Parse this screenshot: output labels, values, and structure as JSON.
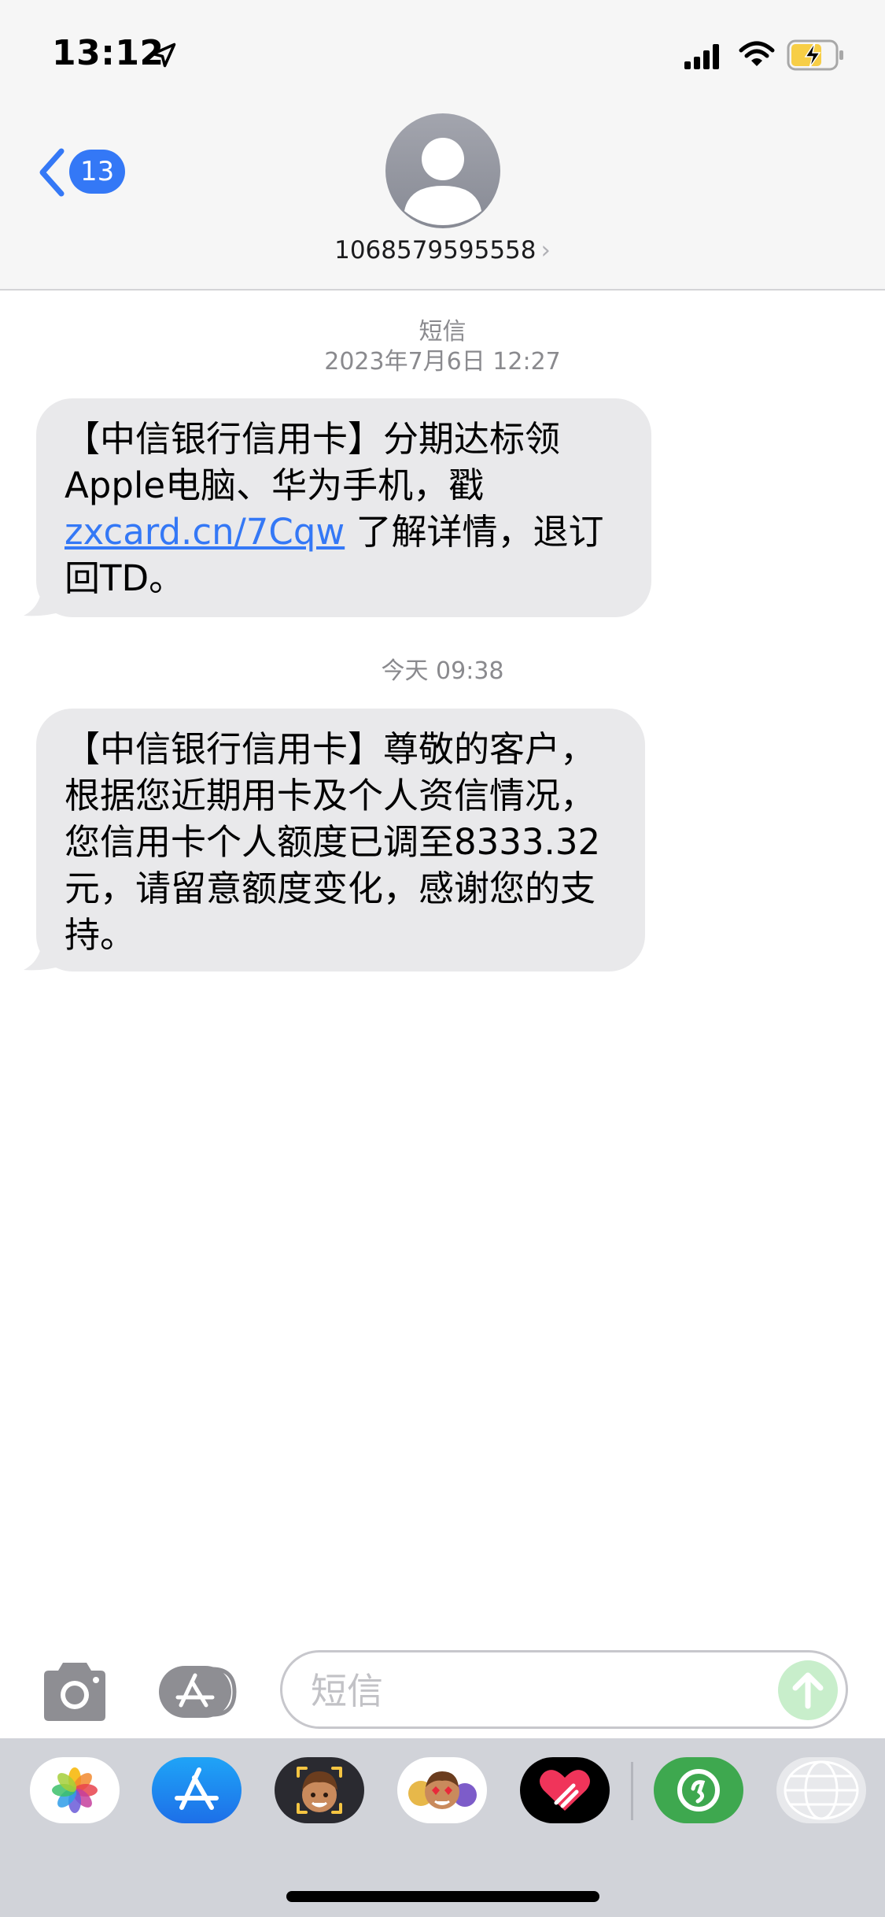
{
  "status_bar": {
    "time": "13:12",
    "icons": [
      "location-arrow-icon",
      "cellular-signal-icon",
      "wifi-icon",
      "battery-charging-icon"
    ],
    "battery_color": "#f7ce46"
  },
  "header": {
    "back_badge": "13",
    "contact_name": "1068579595558",
    "chevron": "›",
    "accent_color": "#3478f6"
  },
  "conversation": {
    "header_label": "短信",
    "first_timestamp": "2023年7月6日 12:27",
    "messages": [
      {
        "text_before_link": "【中信银行信用卡】分期达标领Apple电脑、华为手机，戳",
        "link_text": "zxcard.cn/7Cqw",
        "text_after_link": "了解详情，退订回TD。"
      },
      {
        "timestamp": "今天 09:38",
        "text": "【中信银行信用卡】尊敬的客户，根据您近期用卡及个人资信情况，您信用卡个人额度已调至8333.32元，请留意额度变化，感谢您的支持。"
      }
    ]
  },
  "input_bar": {
    "placeholder": "短信",
    "icons": [
      "camera-icon",
      "app-store-icon",
      "send-arrow-icon"
    ]
  },
  "app_drawer": {
    "apps": [
      "photos-icon",
      "app-store-icon",
      "memoji-icon",
      "animoji-icon",
      "digital-touch-icon",
      "green-app-icon",
      "globe-app-icon"
    ]
  }
}
